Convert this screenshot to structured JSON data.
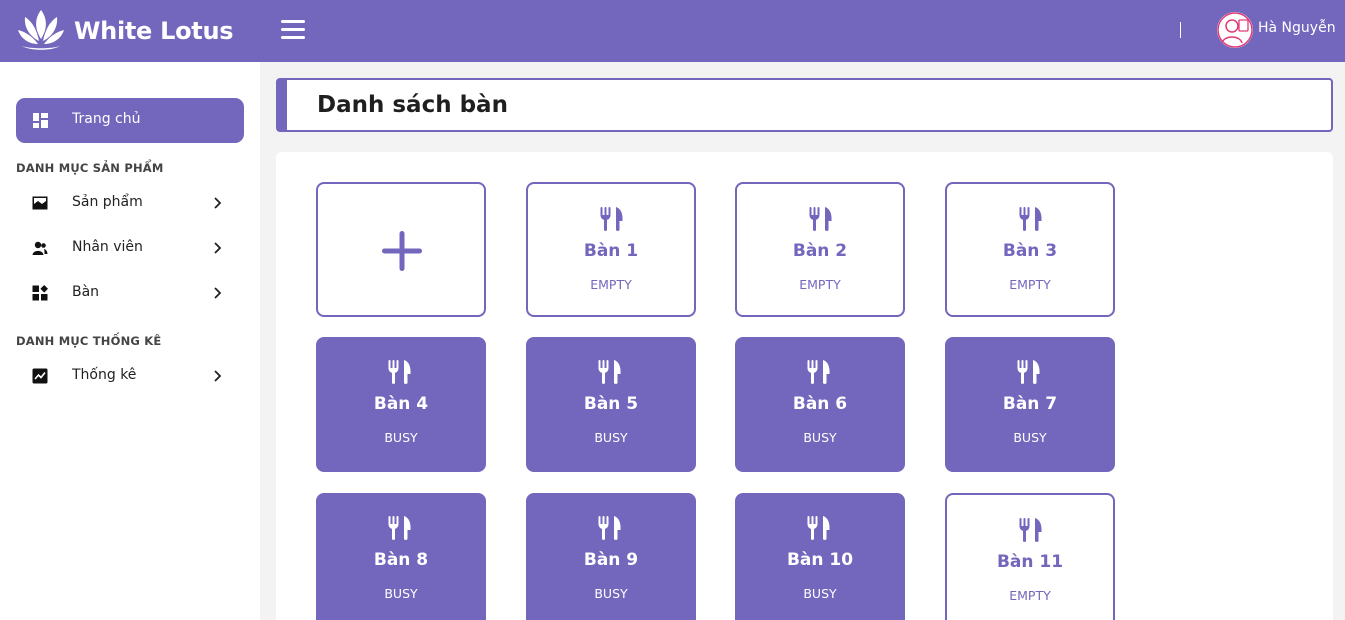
{
  "app": {
    "name": "White Lotus"
  },
  "user": {
    "name": "Hà Nguyễn"
  },
  "sidebar": {
    "home_label": "Trang chủ",
    "section_products": "DANH MỤC SẢN PHẨM",
    "section_stats": "DANH MỤC THỐNG KÊ",
    "items": [
      {
        "label": "Sản phẩm",
        "icon": "image-icon"
      },
      {
        "label": "Nhân viên",
        "icon": "users-icon"
      },
      {
        "label": "Bàn",
        "icon": "grid-icon"
      },
      {
        "label": "Thống kê",
        "icon": "chart-icon"
      }
    ]
  },
  "page": {
    "title": "Danh sách bàn"
  },
  "tables": [
    {
      "name": "Bàn 1",
      "status": "EMPTY"
    },
    {
      "name": "Bàn 2",
      "status": "EMPTY"
    },
    {
      "name": "Bàn 3",
      "status": "EMPTY"
    },
    {
      "name": "Bàn 4",
      "status": "BUSY"
    },
    {
      "name": "Bàn 5",
      "status": "BUSY"
    },
    {
      "name": "Bàn 6",
      "status": "BUSY"
    },
    {
      "name": "Bàn 7",
      "status": "BUSY"
    },
    {
      "name": "Bàn 8",
      "status": "BUSY"
    },
    {
      "name": "Bàn 9",
      "status": "BUSY"
    },
    {
      "name": "Bàn 10",
      "status": "BUSY"
    },
    {
      "name": "Bàn 11",
      "status": "EMPTY"
    }
  ],
  "colors": {
    "accent": "#7366bd",
    "background": "#f3f3f4"
  }
}
